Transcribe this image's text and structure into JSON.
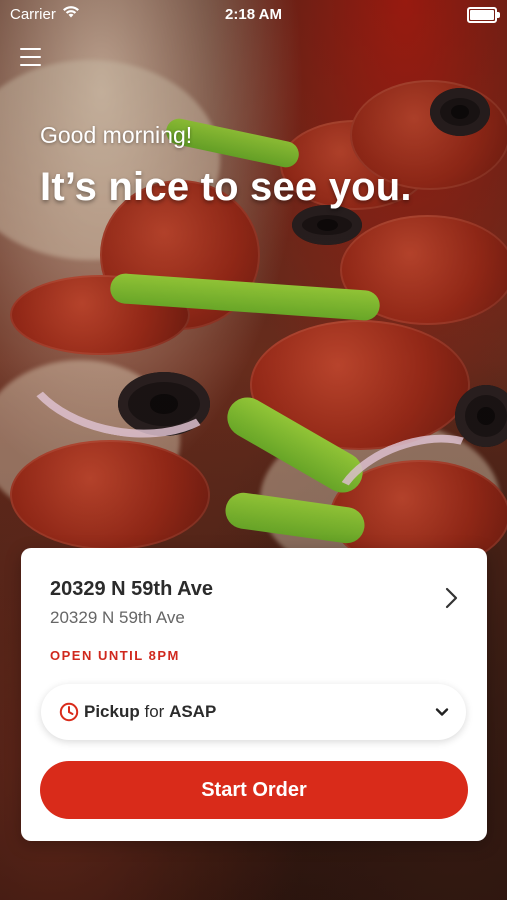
{
  "status_bar": {
    "carrier": "Carrier",
    "time": "2:18 AM",
    "icons": [
      "wifi-icon",
      "battery-icon"
    ]
  },
  "header": {
    "menu_icon": "hamburger-menu-icon"
  },
  "hero": {
    "greeting": "Good morning!",
    "headline": "It’s nice to see you."
  },
  "location_card": {
    "name": "20329 N 59th Ave",
    "address": "20329 N 59th Ave",
    "hours": "OPEN UNTIL 8PM",
    "chevron_icon": "chevron-right-icon",
    "order_mode": {
      "icon": "clock-icon",
      "mode": "Pickup",
      "connector": "for",
      "time": "ASAP",
      "dropdown_icon": "chevron-down-icon"
    },
    "start_order_label": "Start Order"
  },
  "colors": {
    "accent_red": "#d92b1a",
    "hours_red": "#d0281d",
    "text_dark": "#2b2b2b",
    "text_muted": "#666666",
    "card_bg": "#ffffff"
  }
}
